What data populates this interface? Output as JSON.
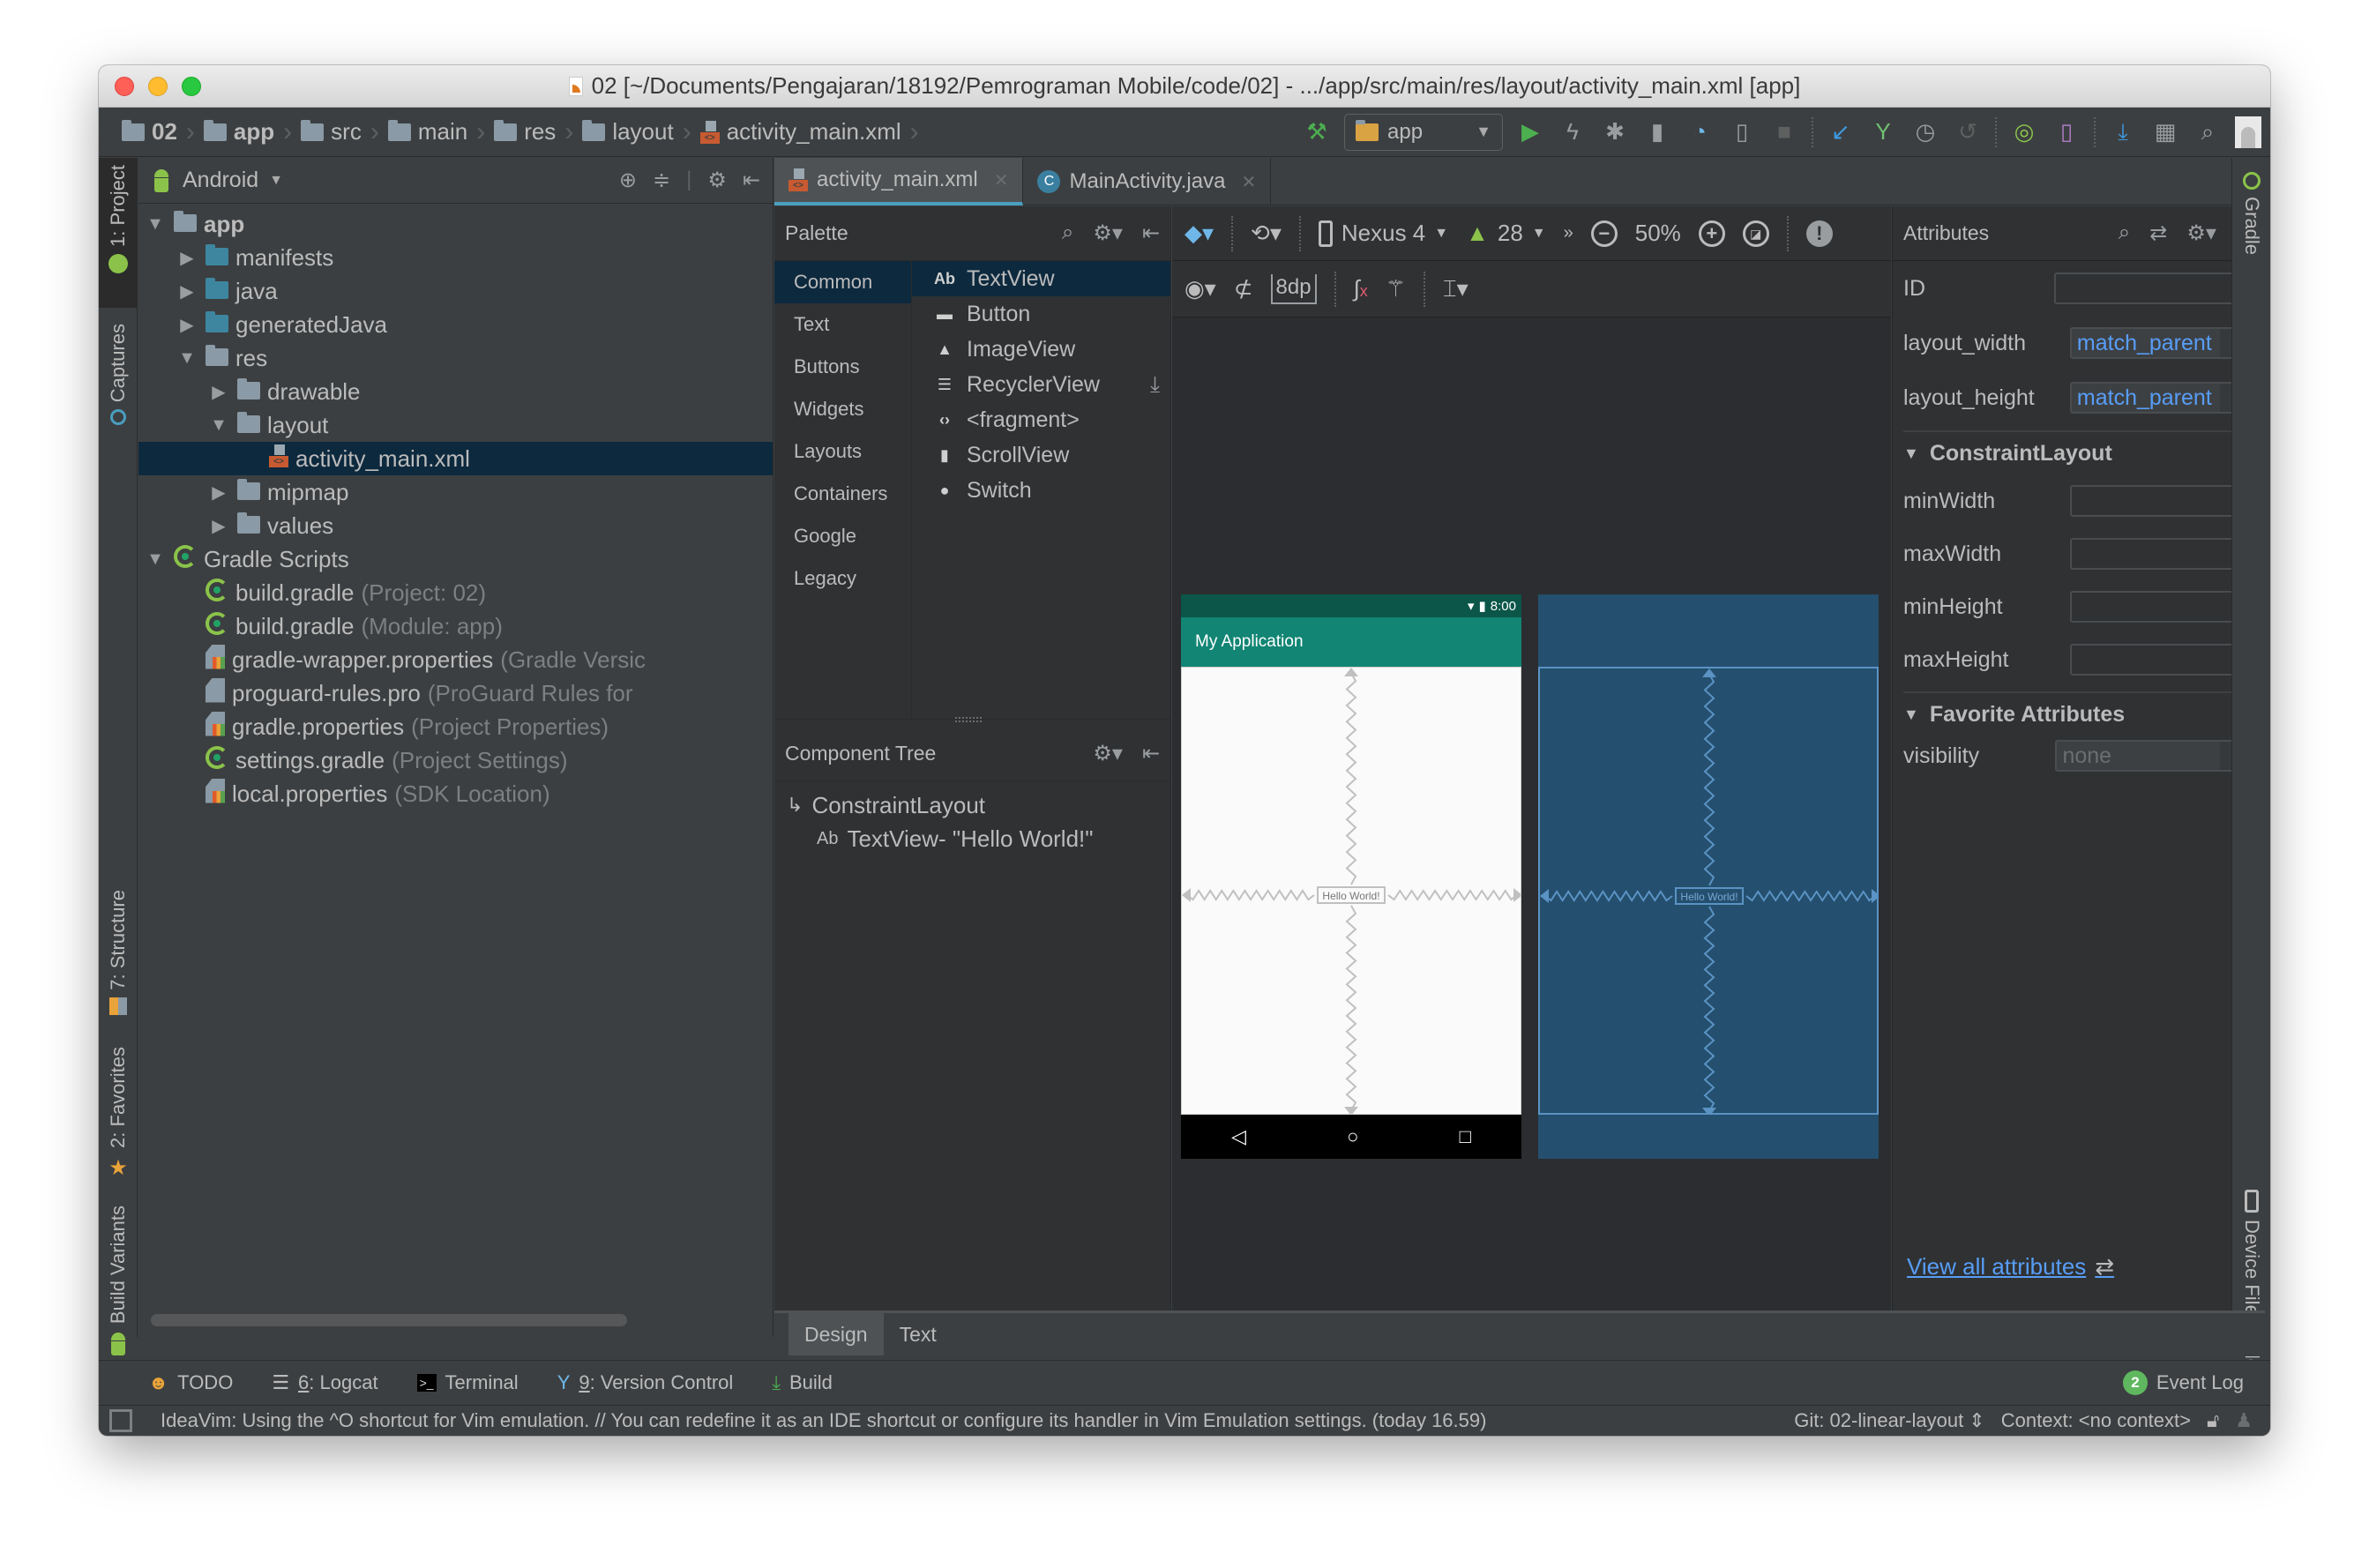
{
  "window": {
    "title": "02 [~/Documents/Pengajaran/18192/Pemrograman Mobile/code/02] - .../app/src/main/res/layout/activity_main.xml [app]"
  },
  "breadcrumbs": [
    {
      "label": "02",
      "icon": "project-folder-icon"
    },
    {
      "label": "app",
      "icon": "module-folder-icon"
    },
    {
      "label": "src",
      "icon": "folder-icon"
    },
    {
      "label": "main",
      "icon": "folder-icon"
    },
    {
      "label": "res",
      "icon": "res-folder-icon"
    },
    {
      "label": "layout",
      "icon": "package-folder-icon"
    },
    {
      "label": "activity_main.xml",
      "icon": "xml-layout-icon"
    }
  ],
  "toolbar": {
    "run_config": "app",
    "icons": [
      "make-hammer-icon",
      "run-icon",
      "apply-changes-icon",
      "debug-icon",
      "profile-icon",
      "attach-debugger-icon",
      "device-debug-icon",
      "stop-icon",
      "vcs-update-icon",
      "vcs-commit-icon",
      "vcs-history-icon",
      "vcs-revert-icon",
      "gradle-sync-icon",
      "avd-manager-icon",
      "sdk-manager-icon",
      "project-structure-icon",
      "search-icon",
      "user-avatar-icon"
    ]
  },
  "left_stripe": {
    "project": "1: Project",
    "captures": "Captures",
    "structure": "7: Structure",
    "favorites": "2: Favorites",
    "build_variants": "Build Variants"
  },
  "right_stripe": {
    "gradle": "Gradle",
    "device_file_explorer": "Device File Explorer"
  },
  "project_panel": {
    "view_mode": "Android",
    "tree": [
      {
        "label": "app",
        "level": 0,
        "expanded": true,
        "bold": true,
        "icon": "module"
      },
      {
        "label": "manifests",
        "level": 1,
        "expanded": false,
        "icon": "folder-blue"
      },
      {
        "label": "java",
        "level": 1,
        "expanded": false,
        "icon": "folder-blue"
      },
      {
        "label": "generatedJava",
        "level": 1,
        "expanded": false,
        "icon": "folder-gen"
      },
      {
        "label": "res",
        "level": 1,
        "expanded": true,
        "icon": "folder-res"
      },
      {
        "label": "drawable",
        "level": 2,
        "expanded": false,
        "icon": "folder"
      },
      {
        "label": "layout",
        "level": 2,
        "expanded": true,
        "icon": "folder"
      },
      {
        "label": "activity_main.xml",
        "level": 3,
        "leaf": true,
        "selected": true,
        "icon": "xml"
      },
      {
        "label": "mipmap",
        "level": 2,
        "expanded": false,
        "icon": "folder"
      },
      {
        "label": "values",
        "level": 2,
        "expanded": false,
        "icon": "folder"
      },
      {
        "label": "Gradle Scripts",
        "level": 0,
        "expanded": true,
        "icon": "gradle"
      },
      {
        "label": "build.gradle",
        "hint": "(Project: 02)",
        "level": 1,
        "leaf": true,
        "icon": "gradle"
      },
      {
        "label": "build.gradle",
        "hint": "(Module: app)",
        "level": 1,
        "leaf": true,
        "icon": "gradle"
      },
      {
        "label": "gradle-wrapper.properties",
        "hint": "(Gradle Versic",
        "level": 1,
        "leaf": true,
        "icon": "props"
      },
      {
        "label": "proguard-rules.pro",
        "hint": "(ProGuard Rules for",
        "level": 1,
        "leaf": true,
        "icon": "file"
      },
      {
        "label": "gradle.properties",
        "hint": "(Project Properties)",
        "level": 1,
        "leaf": true,
        "icon": "props"
      },
      {
        "label": "settings.gradle",
        "hint": "(Project Settings)",
        "level": 1,
        "leaf": true,
        "icon": "gradle"
      },
      {
        "label": "local.properties",
        "hint": "(SDK Location)",
        "level": 1,
        "leaf": true,
        "icon": "props"
      }
    ]
  },
  "editor_tabs": [
    {
      "label": "activity_main.xml",
      "active": true,
      "icon": "xml-layout-icon"
    },
    {
      "label": "MainActivity.java",
      "active": false,
      "icon": "java-class-icon"
    }
  ],
  "palette": {
    "title": "Palette",
    "categories": [
      "Common",
      "Text",
      "Buttons",
      "Widgets",
      "Layouts",
      "Containers",
      "Google",
      "Legacy"
    ],
    "selected_category": "Common",
    "items": [
      {
        "label": "TextView",
        "icon": "Ab",
        "selected": true
      },
      {
        "label": "Button",
        "icon": "▬"
      },
      {
        "label": "ImageView",
        "icon": "▲"
      },
      {
        "label": "RecyclerView",
        "icon": "☰",
        "download": true
      },
      {
        "label": "<fragment>",
        "icon": "‹›"
      },
      {
        "label": "ScrollView",
        "icon": "▮"
      },
      {
        "label": "Switch",
        "icon": "●"
      }
    ]
  },
  "component_tree": {
    "title": "Component Tree",
    "root": "ConstraintLayout",
    "child_prefix": "Ab",
    "child": "TextView- \"Hello World!\""
  },
  "design_toolbar": {
    "device": "Nexus 4",
    "api_level": "28",
    "zoom": "50%",
    "default_margin": "8dp"
  },
  "preview": {
    "status_time": "8:00",
    "app_title": "My Application",
    "text_view": "Hello World!"
  },
  "attributes": {
    "title": "Attributes",
    "id_label": "ID",
    "id_value": "",
    "layout_width_label": "layout_width",
    "layout_width_value": "match_parent",
    "layout_height_label": "layout_height",
    "layout_height_value": "match_parent",
    "constraint_section": "ConstraintLayout",
    "constraint_fields": [
      {
        "label": "minWidth",
        "value": ""
      },
      {
        "label": "maxWidth",
        "value": ""
      },
      {
        "label": "minHeight",
        "value": ""
      },
      {
        "label": "maxHeight",
        "value": ""
      }
    ],
    "favorites_section": "Favorite Attributes",
    "visibility_label": "visibility",
    "visibility_value": "none",
    "view_all": "View all attributes"
  },
  "design_tabs": [
    {
      "label": "Design",
      "active": true
    },
    {
      "label": "Text",
      "active": false
    }
  ],
  "tool_windows": [
    {
      "label": "TODO",
      "icon": "todo-icon"
    },
    {
      "mnemonic": "6",
      "label": ": Logcat",
      "icon": "logcat-icon"
    },
    {
      "label": "Terminal",
      "icon": "terminal-icon"
    },
    {
      "mnemonic": "9",
      "label": ": Version Control",
      "icon": "version-control-icon"
    },
    {
      "label": "Build",
      "icon": "build-icon"
    }
  ],
  "event_log": {
    "label": "Event Log",
    "count": "2"
  },
  "status": {
    "message": "IdeaVim: Using the ^O shortcut for Vim emulation. // You can redefine it as an IDE shortcut or configure its handler in Vim Emulation settings. (today 16.59)",
    "git_branch": "Git: 02-linear-layout",
    "context": "Context: <no context>"
  },
  "colors": {
    "accent_blue": "#4a9ec0",
    "link_blue": "#589df6",
    "selection": "#0d293e",
    "app_bar": "#128574",
    "status_bar": "#0b5648",
    "blueprint": "#254f6e",
    "android_green": "#8bc34a"
  }
}
